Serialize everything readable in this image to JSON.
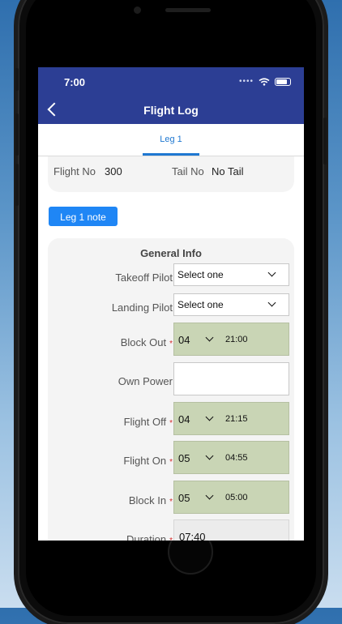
{
  "status_bar": {
    "time": "7:00"
  },
  "nav": {
    "title": "Flight Log"
  },
  "tabs": [
    {
      "label": "Leg 1"
    }
  ],
  "flight_info": {
    "flight_no_label": "Flight No",
    "flight_no": "300",
    "tail_no_label": "Tail No",
    "tail_no": "No Tail"
  },
  "note_button": "Leg 1 note",
  "general_info": {
    "title": "General Info",
    "takeoff_pilot": {
      "label": "Takeoff Pilot",
      "value": "Select one"
    },
    "landing_pilot": {
      "label": "Landing Pilot",
      "value": "Select one"
    },
    "block_out": {
      "label": "Block Out",
      "hour": "04",
      "time": "21:00"
    },
    "own_power": {
      "label": "Own Power",
      "value": ""
    },
    "flight_off": {
      "label": "Flight Off",
      "hour": "04",
      "time": "21:15"
    },
    "flight_on": {
      "label": "Flight On",
      "hour": "05",
      "time": "04:55"
    },
    "block_in": {
      "label": "Block In",
      "hour": "05",
      "time": "05:00"
    },
    "duration": {
      "label": "Duration",
      "value": "07:40"
    },
    "required_mark": "*"
  },
  "colors": {
    "nav_bar": "#2c3e94",
    "accent": "#1f78d1",
    "note_button": "#1f86f5",
    "time_field": "#c9d5b5",
    "required": "#d42a2a"
  }
}
